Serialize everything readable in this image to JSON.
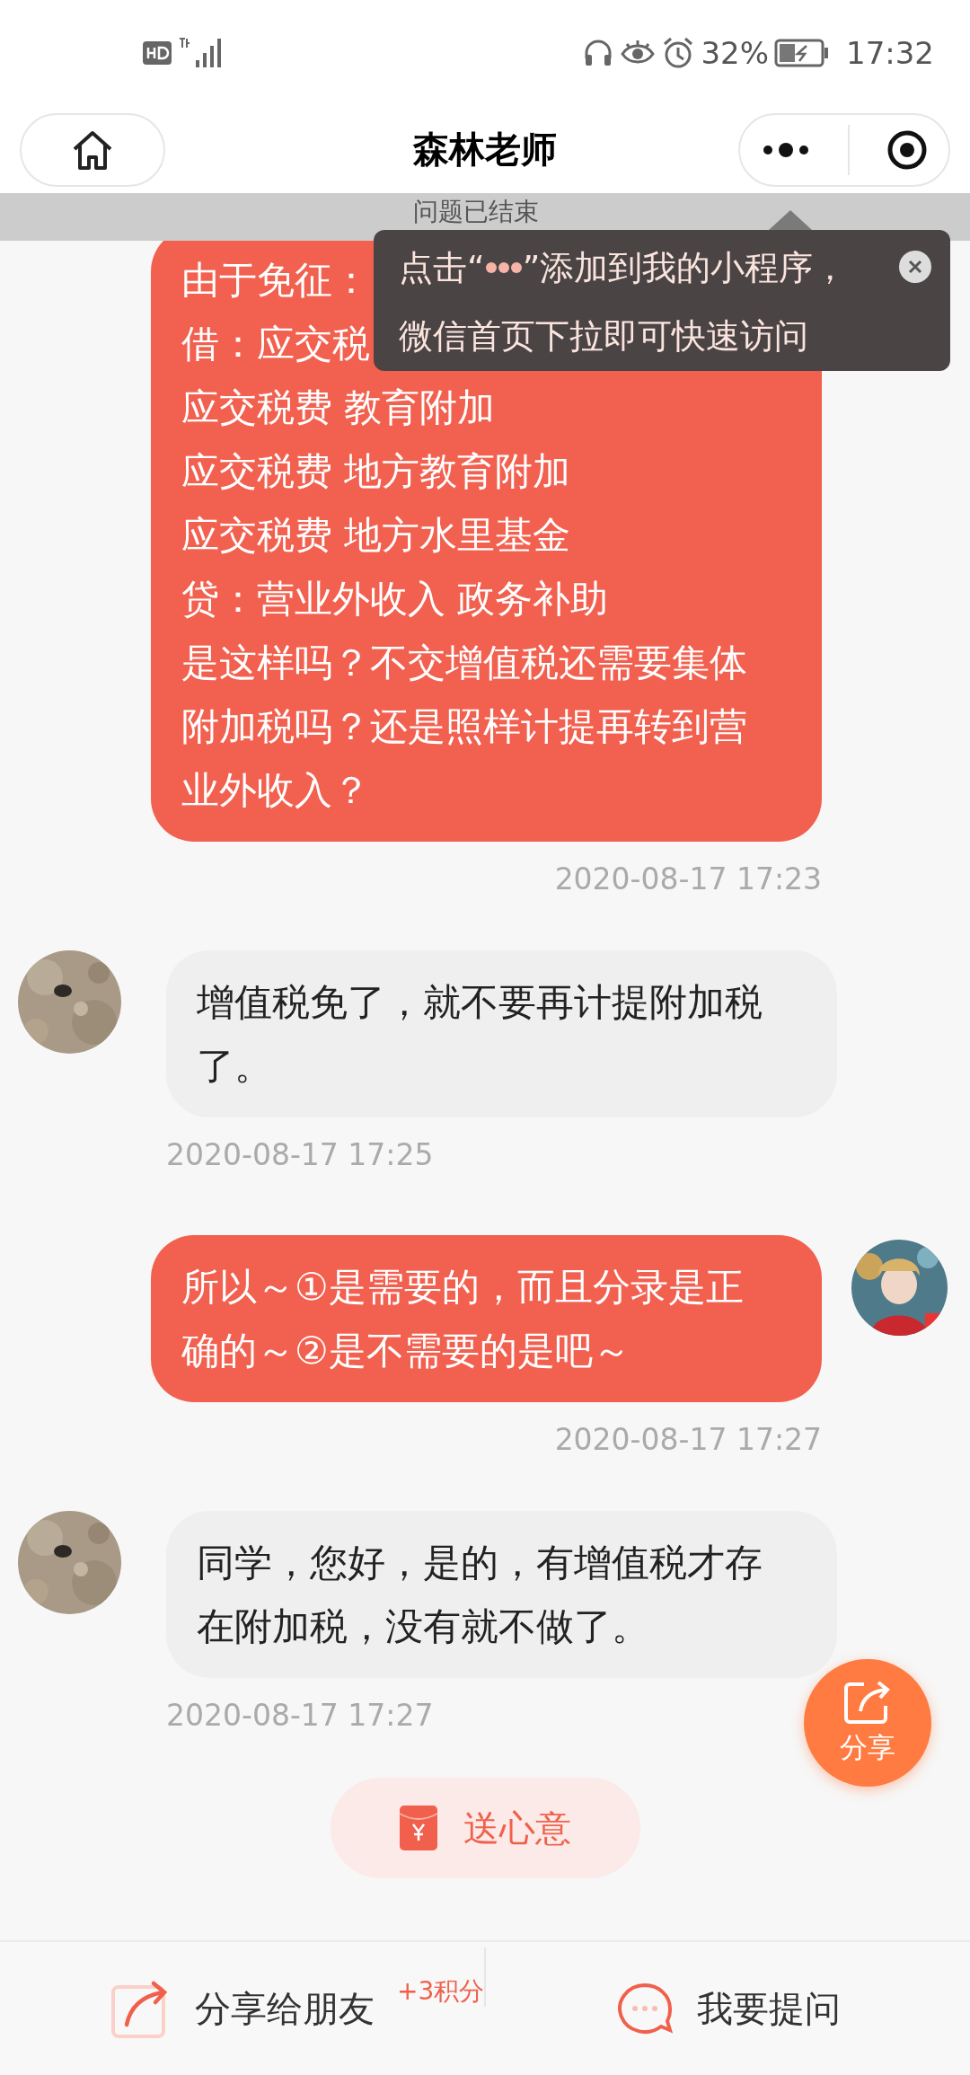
{
  "status_bar": {
    "battery": "32%",
    "time": "17:32"
  },
  "nav": {
    "title": "森林老师"
  },
  "banner": {
    "text": "问题已结束"
  },
  "tip": {
    "before": "点击“",
    "after": "”添加到我的小程序，",
    "line2": "微信首页下拉即可快速访问"
  },
  "messages": [
    {
      "kind": "outgoing",
      "lines": [
        "由于免征：",
        "借：应交税",
        "应交税费 教育附加",
        "应交税费 地方教育附加",
        "应交税费 地方水里基金",
        "贷：营业外收入 政务补助",
        "是这样吗？不交增值税还需要集体",
        "附加税吗？还是照样计提再转到营",
        "业外收入？"
      ],
      "time": "2020-08-17 17:23"
    },
    {
      "kind": "incoming",
      "lines": [
        "增值税免了，就不要再计提附加税",
        "了。"
      ],
      "time": "2020-08-17 17:25"
    },
    {
      "kind": "outgoing",
      "lines": [
        "所以～①是需要的，而且分录是正",
        "确的～②是不需要的是吧～"
      ],
      "time": "2020-08-17 17:27"
    },
    {
      "kind": "incoming",
      "lines": [
        "同学，您好，是的，有增值税才存",
        "在附加税，没有就不做了。"
      ],
      "time": "2020-08-17 17:27"
    }
  ],
  "share_fab": {
    "label": "分享"
  },
  "gift_button": {
    "label": "送心意"
  },
  "bottom_bar": {
    "share": "分享给朋友",
    "share_badge": "+3积分",
    "ask": "我要提问"
  }
}
